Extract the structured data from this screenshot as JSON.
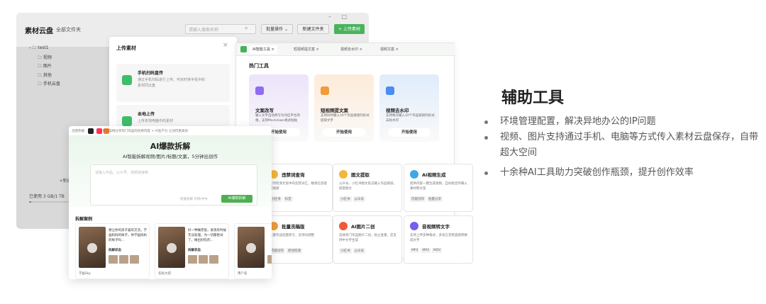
{
  "cloud": {
    "title": "素材云盘",
    "subtitle": "全部文件夹",
    "search_placeholder": "请输入搜索名称",
    "btn_batch": "批量操作 ⌄",
    "btn_newfolder": "新建文件夹",
    "btn_upload": "+ 上传素材",
    "window_controls": "– □",
    "tree": [
      "› 🗀 test1",
      "🗀 视频",
      "🗀 图片",
      "🗀 其他",
      "🗀 手机云盘"
    ],
    "new_folder": "+新建文件",
    "used": "已使用 3 GB/1 TB"
  },
  "upload_dialog": {
    "title": "上传素材",
    "opt1_title": "手机扫码直传",
    "opt1_desc": "通过手机扫码进行上传，可实时将手机中的素材同云盘",
    "opt2_title": "本地上传",
    "opt2_desc": "上传本地电脑中的素材"
  },
  "tools": {
    "tabs": [
      "AI智能工具 ×",
      "短视频提文案 ×",
      "视频去水印 ×",
      "视频文案 ×"
    ],
    "hot_title": "热门工具",
    "cards": [
      {
        "title": "文案改写",
        "desc": "输入文字自动改写为对应平台风格，支持Markdown格式粘贴",
        "btn": "开始使用",
        "color": "#ece3fb",
        "icon": "#8f6cf0"
      },
      {
        "title": "短视频提文案",
        "desc": "支持同时输入10个作品链接的形式提取文字",
        "btn": "开始使用",
        "color": "#fdebd9",
        "icon": "#f29b3d"
      },
      {
        "title": "视频去水印",
        "desc": "支持每次输入10个作品链接的形式去除水印",
        "btn": "开始使用",
        "color": "#e0ecfb",
        "icon": "#4a8df0"
      }
    ],
    "small_cards": [
      {
        "title": "违禁词查询",
        "desc": "实时检测文案中的违禁词汇，敏感信息提前规避",
        "tags": [
          "小红书",
          "抖音"
        ],
        "icon": "#f4b63a"
      },
      {
        "title": "图文提取",
        "desc": "公众号、小红书图文笔记输入作品链接，提取图文",
        "tags": [
          "小红书",
          "公众号"
        ],
        "icon": "#f4b63a"
      },
      {
        "title": "AI视频生成",
        "desc": "提供内容一键生成视频，自动组合作输入素材和文案",
        "tags": [
          "内容创作",
          "批量分享"
        ],
        "icon": "#3fa7e8"
      },
      {
        "title": "批量洗稿版",
        "desc": "大量作品批量改写，支持同调整",
        "tags": [
          "内容创作",
          "原创检测"
        ],
        "icon": "#f29b3d"
      },
      {
        "title": "AI图片二创",
        "desc": "选择热门作品图片二创，防止查重，还支持中文字生成",
        "tags": [
          "小红书",
          "公众号"
        ],
        "icon": "#f05a3a"
      },
      {
        "title": "音视频转文字",
        "desc": "支持上传多种格式，多语言音频直接转换成文字",
        "tags": [
          "MP3",
          "MP4",
          "MOV"
        ],
        "icon": "#7a5cf0"
      }
    ]
  },
  "ai_panel": {
    "topbar": "灵感热搜　  　　　　 更多案例分享热门作品的优秀内容    + AI生产力 让创作更高效",
    "title": "AI爆款拆解",
    "subtitle": "AI智能拆解视频/图片/标题/文案，5分钟出创作",
    "placeholder": "请输入作品、公众号、视频链接等",
    "hint": "智能拆解  示例/中文",
    "go": "AI爆款拆解",
    "cases_title": "拆解案例",
    "videos": [
      {
        "text": "想让你的孩子喜欢交流，学画妈妈的样子，你学画妈妈的样子吗...",
        "label": "拆解状态",
        "user": "学画Sky"
      },
      {
        "text": "好一种做完饭，发现有时候无法处理，为一切都尝试了，做出好吃的...",
        "label": "拆解状态",
        "user": "农民大叔"
      },
      {
        "text": "",
        "label": "",
        "user": "用户名"
      }
    ]
  },
  "feature": {
    "title": "辅助工具",
    "bullets": [
      "环境管理配置，解决异地办公的IP问题",
      "视频、图片支持通过手机、电脑等方式传入素材云盘保存，自带超大空间",
      "十余种AI工具助力突破创作瓶颈，提升创作效率"
    ]
  }
}
